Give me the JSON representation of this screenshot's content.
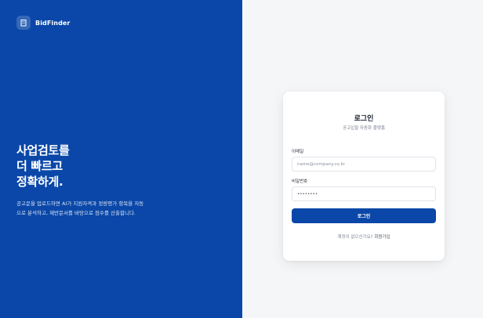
{
  "brand": {
    "name": "BidFinder",
    "logo_icon": "building-icon"
  },
  "hero": {
    "headline_lines": [
      "사업검토를",
      "더 빠르고",
      "정확하게."
    ],
    "description_lines": [
      "공고문을 업로드하면 AI가 지원자격과 정량평가 항목을 자동",
      "으로 분석하고, 제반문서를 바탕으로 점수를 산출합니다."
    ]
  },
  "login_form": {
    "title": "로그인",
    "subtitle": "공고입찰 자동화 플랫폼",
    "email": {
      "label": "이메일",
      "placeholder": "name@company.co.kr",
      "value": ""
    },
    "password": {
      "label": "비밀번호",
      "placeholder": "",
      "value": "••••••••"
    },
    "submit_label": "로그인",
    "signup_prompt": "계정이 없으신가요?",
    "signup_link": "회원가입"
  },
  "colors": {
    "brand_blue": "#0a47a8",
    "background": "#f5f6f8",
    "card": "#ffffff"
  }
}
